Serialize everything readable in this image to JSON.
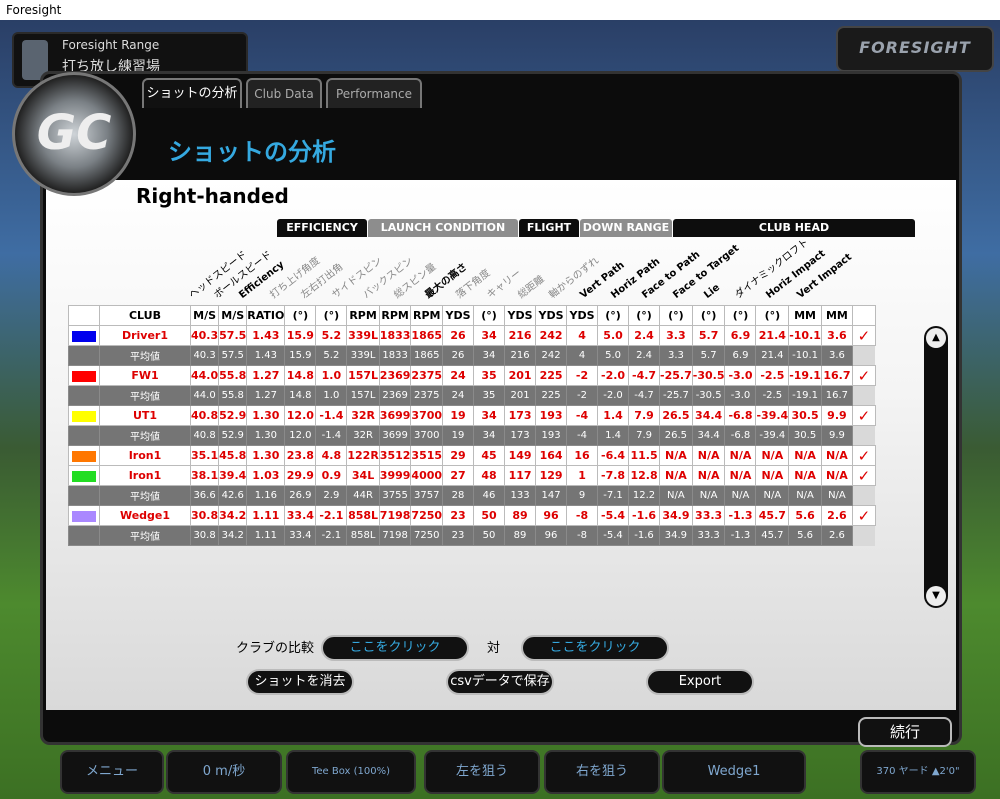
{
  "window_title": "Foresight",
  "range": {
    "line1": "Foresight Range",
    "line2": "打ち放し練習場"
  },
  "logo_text": "FORESIGHT",
  "gc_logo": "GC",
  "tabs": [
    {
      "label": "ショットの分析",
      "active": true
    },
    {
      "label": "Club Data",
      "active": false
    },
    {
      "label": "Performance",
      "active": false
    }
  ],
  "section_title": "ショットの分析",
  "handedness": "Right-handed",
  "categories": [
    "EFFICIENCY",
    "LAUNCH CONDITION",
    "FLIGHT",
    "DOWN RANGE",
    "CLUB HEAD"
  ],
  "column_names": [
    "ヘッドスピード",
    "ボールスピード",
    "Efficiency",
    "打ち上げ角度",
    "左右打出角",
    "サイドスピン",
    "バックスピン",
    "総スピン量",
    "最大の高さ",
    "落下角度",
    "キャリー",
    "総距離",
    "軸からのずれ",
    "Vert Path",
    "Horiz Path",
    "Face to Path",
    "Face to Target",
    "Lie",
    "ダイナミックロフト",
    "Horiz Impact",
    "Vert Impact"
  ],
  "units": [
    "M/S",
    "M/S",
    "RATIO",
    "(°)",
    "(°)",
    "RPM",
    "RPM",
    "RPM",
    "YDS",
    "(°)",
    "YDS",
    "YDS",
    "YDS",
    "(°)",
    "(°)",
    "(°)",
    "(°)",
    "(°)",
    "(°)",
    "MM",
    "MM"
  ],
  "club_header": "CLUB",
  "average_label": "平均値",
  "rows": [
    {
      "type": "shot",
      "club": "Driver1",
      "color": "#0000ee",
      "checked": true,
      "values": [
        "40.3",
        "57.5",
        "1.43",
        "15.9",
        "5.2",
        "339L",
        "1833",
        "1865",
        "26",
        "34",
        "216",
        "242",
        "4",
        "5.0",
        "2.4",
        "3.3",
        "5.7",
        "6.9",
        "21.4",
        "-10.1",
        "3.6"
      ]
    },
    {
      "type": "avg",
      "values": [
        "40.3",
        "57.5",
        "1.43",
        "15.9",
        "5.2",
        "339L",
        "1833",
        "1865",
        "26",
        "34",
        "216",
        "242",
        "4",
        "5.0",
        "2.4",
        "3.3",
        "5.7",
        "6.9",
        "21.4",
        "-10.1",
        "3.6"
      ]
    },
    {
      "type": "shot",
      "club": "FW1",
      "color": "#ff0000",
      "checked": true,
      "values": [
        "44.0",
        "55.8",
        "1.27",
        "14.8",
        "1.0",
        "157L",
        "2369",
        "2375",
        "24",
        "35",
        "201",
        "225",
        "-2",
        "-2.0",
        "-4.7",
        "-25.7",
        "-30.5",
        "-3.0",
        "-2.5",
        "-19.1",
        "16.7"
      ]
    },
    {
      "type": "avg",
      "values": [
        "44.0",
        "55.8",
        "1.27",
        "14.8",
        "1.0",
        "157L",
        "2369",
        "2375",
        "24",
        "35",
        "201",
        "225",
        "-2",
        "-2.0",
        "-4.7",
        "-25.7",
        "-30.5",
        "-3.0",
        "-2.5",
        "-19.1",
        "16.7"
      ]
    },
    {
      "type": "shot",
      "club": "UT1",
      "color": "#ffff00",
      "checked": true,
      "values": [
        "40.8",
        "52.9",
        "1.30",
        "12.0",
        "-1.4",
        "32R",
        "3699",
        "3700",
        "19",
        "34",
        "173",
        "193",
        "-4",
        "1.4",
        "7.9",
        "26.5",
        "34.4",
        "-6.8",
        "-39.4",
        "30.5",
        "9.9"
      ]
    },
    {
      "type": "avg",
      "values": [
        "40.8",
        "52.9",
        "1.30",
        "12.0",
        "-1.4",
        "32R",
        "3699",
        "3700",
        "19",
        "34",
        "173",
        "193",
        "-4",
        "1.4",
        "7.9",
        "26.5",
        "34.4",
        "-6.8",
        "-39.4",
        "30.5",
        "9.9"
      ]
    },
    {
      "type": "shot",
      "club": "Iron1",
      "color": "#ff7700",
      "checked": true,
      "values": [
        "35.1",
        "45.8",
        "1.30",
        "23.8",
        "4.8",
        "122R",
        "3512",
        "3515",
        "29",
        "45",
        "149",
        "164",
        "16",
        "-6.4",
        "11.5",
        "N/A",
        "N/A",
        "N/A",
        "N/A",
        "N/A",
        "N/A"
      ]
    },
    {
      "type": "shot",
      "club": "Iron1",
      "color": "#22dd22",
      "checked": true,
      "values": [
        "38.1",
        "39.4",
        "1.03",
        "29.9",
        "0.9",
        "34L",
        "3999",
        "4000",
        "27",
        "48",
        "117",
        "129",
        "1",
        "-7.8",
        "12.8",
        "N/A",
        "N/A",
        "N/A",
        "N/A",
        "N/A",
        "N/A"
      ]
    },
    {
      "type": "avg",
      "values": [
        "36.6",
        "42.6",
        "1.16",
        "26.9",
        "2.9",
        "44R",
        "3755",
        "3757",
        "28",
        "46",
        "133",
        "147",
        "9",
        "-7.1",
        "12.2",
        "N/A",
        "N/A",
        "N/A",
        "N/A",
        "N/A",
        "N/A"
      ]
    },
    {
      "type": "shot",
      "club": "Wedge1",
      "color": "#aa88ff",
      "checked": true,
      "values": [
        "30.8",
        "34.2",
        "1.11",
        "33.4",
        "-2.1",
        "858L",
        "7198",
        "7250",
        "23",
        "50",
        "89",
        "96",
        "-8",
        "-5.4",
        "-1.6",
        "34.9",
        "33.3",
        "-1.3",
        "45.7",
        "5.6",
        "2.6"
      ]
    },
    {
      "type": "avg",
      "values": [
        "30.8",
        "34.2",
        "1.11",
        "33.4",
        "-2.1",
        "858L",
        "7198",
        "7250",
        "23",
        "50",
        "89",
        "96",
        "-8",
        "-5.4",
        "-1.6",
        "34.9",
        "33.3",
        "-1.3",
        "45.7",
        "5.6",
        "2.6"
      ]
    }
  ],
  "compare_label": "クラブの比較",
  "click_here": "ここをクリック",
  "vs_label": "対",
  "delete_label": "ショットを消去",
  "csv_label": "csvデータで保存",
  "export_label": "Export",
  "continue_label": "続行",
  "bottom_bar": {
    "menu": "メニュー",
    "wind": "0 m/秒",
    "tee": "Tee Box (100%)",
    "left": "左を狙う",
    "right": "右を狙う",
    "club": "Wedge1",
    "distance": "370 ヤード ▲2'0\""
  }
}
